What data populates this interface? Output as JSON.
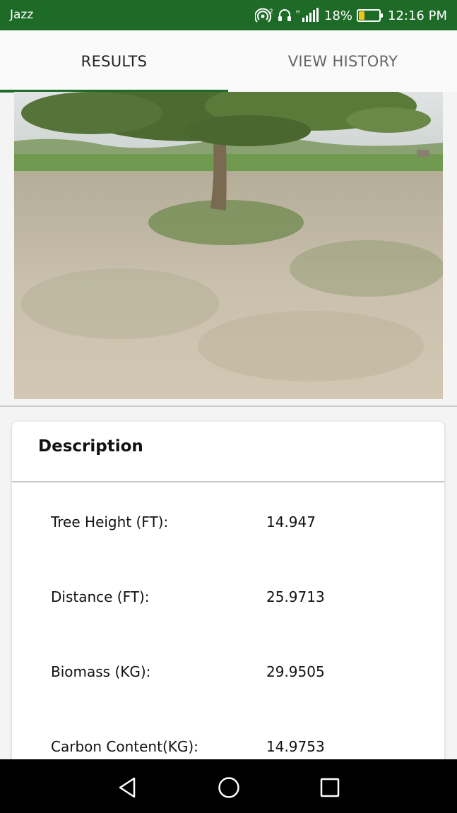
{
  "status_bar": {
    "carrier": "Jazz",
    "battery_percent": "18%",
    "battery_level": 0.18,
    "time": "12:16 PM",
    "icons": [
      "hotspot-icon",
      "headset-icon",
      "signal-icon",
      "battery-icon"
    ]
  },
  "tabs": [
    {
      "label": "RESULTS",
      "selected": true
    },
    {
      "label": "VIEW HISTORY",
      "selected": false
    }
  ],
  "photo": {
    "subject": "tree-field-photo"
  },
  "description": {
    "title": "Description",
    "rows": [
      {
        "label": "Tree Height (FT):",
        "value": "14.947"
      },
      {
        "label": "Distance (FT):",
        "value": "25.9713"
      },
      {
        "label": "Biomass (KG):",
        "value": "29.9505"
      },
      {
        "label": "Carbon Content(KG):",
        "value": "14.9753"
      }
    ]
  },
  "nav_bar": {
    "buttons": [
      "back-icon",
      "home-icon",
      "recents-icon"
    ]
  },
  "colors": {
    "primary": "#1e6a27",
    "battery": "#f2c318"
  }
}
